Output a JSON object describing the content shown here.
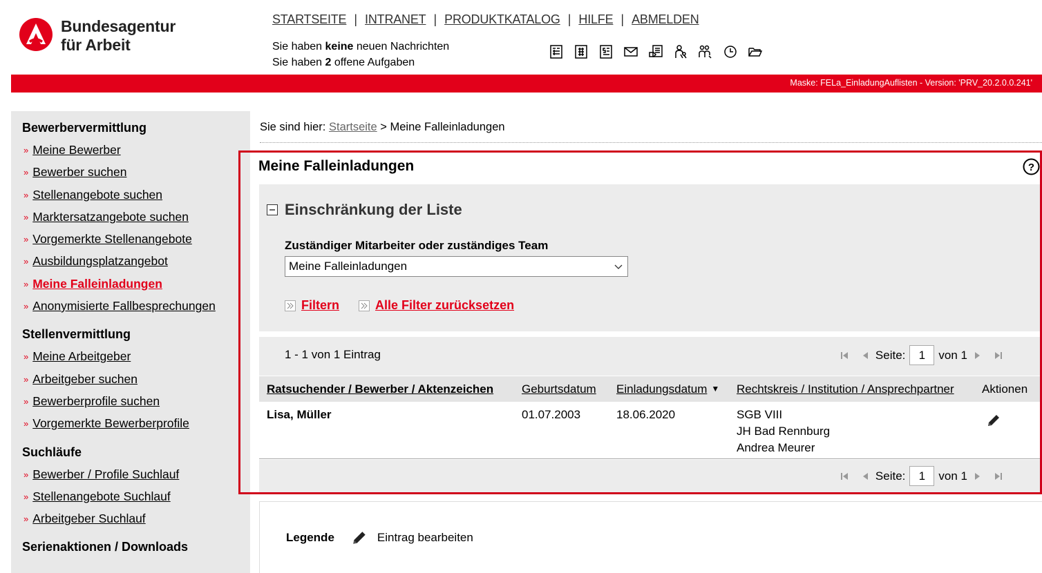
{
  "header": {
    "logo_line1": "Bundesagentur",
    "logo_line2": "für Arbeit",
    "brand_color": "#e2001a",
    "nav": [
      "STARTSEITE",
      "INTRANET",
      "PRODUKTKATALOG",
      "HILFE",
      "ABMELDEN"
    ],
    "msg1_pre": "Sie haben ",
    "msg1_bold": "keine",
    "msg1_post": " neuen Nachrichten",
    "msg2_pre": "Sie haben ",
    "msg2_bold": "2",
    "msg2_post": " offene Aufgaben",
    "tool_icons": [
      "form-icon",
      "form-alt-icon",
      "form-s-icon",
      "mail-icon",
      "document-hand-icon",
      "person-search-icon",
      "people-search-icon",
      "clock-icon",
      "folder-open-icon"
    ],
    "mask_info": "Maske: FELa_EinladungAuflisten - Version: 'PRV_20.2.0.0.241'"
  },
  "sidebar": {
    "sections": [
      {
        "title": "Bewerbervermittlung",
        "items": [
          "Meine Bewerber",
          "Bewerber suchen",
          "Stellenangebote suchen",
          "Marktersatzangebote suchen",
          "Vorgemerkte Stellenangebote",
          "Ausbildungsplatzangebot",
          "Meine Falleinladungen",
          "Anonymisierte Fallbesprechungen"
        ]
      },
      {
        "title": "Stellenvermittlung",
        "items": [
          "Meine Arbeitgeber",
          "Arbeitgeber suchen",
          "Bewerberprofile suchen",
          "Vorgemerkte Bewerberprofile"
        ]
      },
      {
        "title": "Suchläufe",
        "items": [
          "Bewerber / Profile Suchlauf",
          "Stellenangebote Suchlauf",
          "Arbeitgeber Suchlauf"
        ]
      },
      {
        "title": "Serienaktionen / Downloads",
        "items": []
      }
    ],
    "active_item": "Meine Falleinladungen"
  },
  "breadcrumb": {
    "prefix": "Sie sind hier:",
    "link": "Startseite",
    "sep": ">",
    "current": "Meine Falleinladungen"
  },
  "main": {
    "title": "Meine Falleinladungen",
    "filter": {
      "heading": "Einschränkung der Liste",
      "label": "Zuständiger Mitarbeiter oder zuständiges Team",
      "select_value": "Meine Falleinladungen",
      "filter_button": "Filtern",
      "reset_button": "Alle Filter zurücksetzen"
    },
    "count": "1 - 1 von 1 Eintrag",
    "pager": {
      "page_label": "Seite:",
      "page_value": "1",
      "of_label": "von 1"
    },
    "table": {
      "columns": [
        "Ratsuchender / Bewerber / Aktenzeichen",
        "Geburtsdatum",
        "Einladungsdatum",
        "Rechtskreis / Institution / Ansprechpartner",
        "Aktionen"
      ],
      "rows": [
        {
          "name": "Lisa, Müller",
          "birth": "01.07.2003",
          "invite": "18.06.2020",
          "legal": "SGB VIII",
          "institution": "JH Bad Rennburg",
          "contact": "Andrea Meurer"
        }
      ]
    },
    "legend": {
      "title": "Legende",
      "edit_label": "Eintrag bearbeiten"
    }
  }
}
